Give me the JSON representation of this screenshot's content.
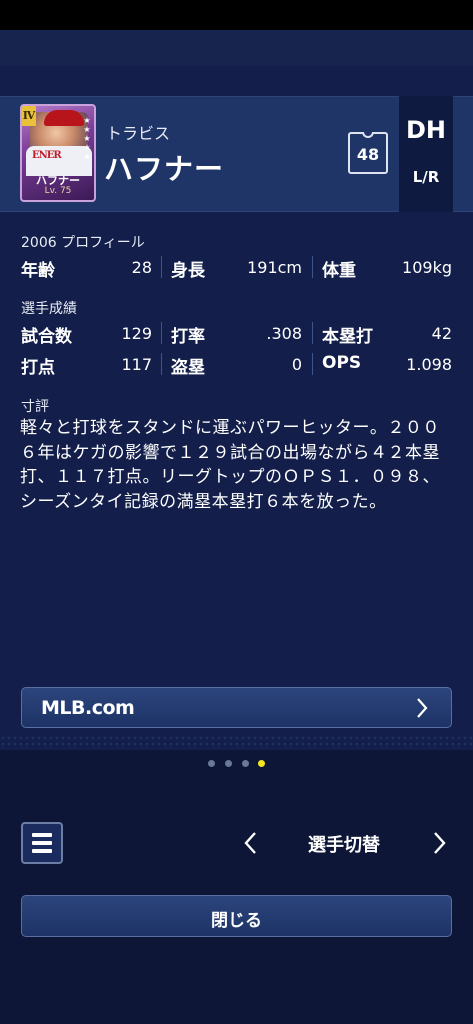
{
  "player": {
    "first_name": "トラビス",
    "last_name": "ハフナー",
    "number": "48",
    "position": "DH",
    "bats_throws": "L/R",
    "card": {
      "rank": "Ⅳ",
      "name": "ハフナー",
      "level": "Lv. 75",
      "jersey_text": "ENER",
      "stars": 5
    }
  },
  "profile": {
    "title": "2006 プロフィール",
    "items": [
      {
        "label": "年齢",
        "value": "28"
      },
      {
        "label": "身長",
        "value": "191cm"
      },
      {
        "label": "体重",
        "value": "109kg"
      }
    ]
  },
  "stats": {
    "title": "選手成績",
    "row1": [
      {
        "label": "試合数",
        "value": "129"
      },
      {
        "label": "打率",
        "value": ".308"
      },
      {
        "label": "本塁打",
        "value": "42"
      }
    ],
    "row2": [
      {
        "label": "打点",
        "value": "117"
      },
      {
        "label": "盗塁",
        "value": "0"
      },
      {
        "label": "OPS",
        "value": "1.098"
      }
    ]
  },
  "review": {
    "title": "寸評",
    "text": "軽々と打球をスタンドに運ぶパワーヒッター。２００６年はケガの影響で１２９試合の出場ながら４２本塁打、１１７打点。リーグトップのＯＰＳ１．０９８、シーズンタイ記録の満塁本塁打６本を放った。"
  },
  "links": {
    "mlb_label": "MLB.com"
  },
  "pager": {
    "pages": 4,
    "active_index": 3
  },
  "nav": {
    "switch_label": "選手切替",
    "close_label": "閉じる"
  },
  "colors": {
    "background": "#131f4a",
    "header": "#1f3568",
    "accent_dot": "#f3e51f",
    "card_purple": "#7a3d98"
  }
}
